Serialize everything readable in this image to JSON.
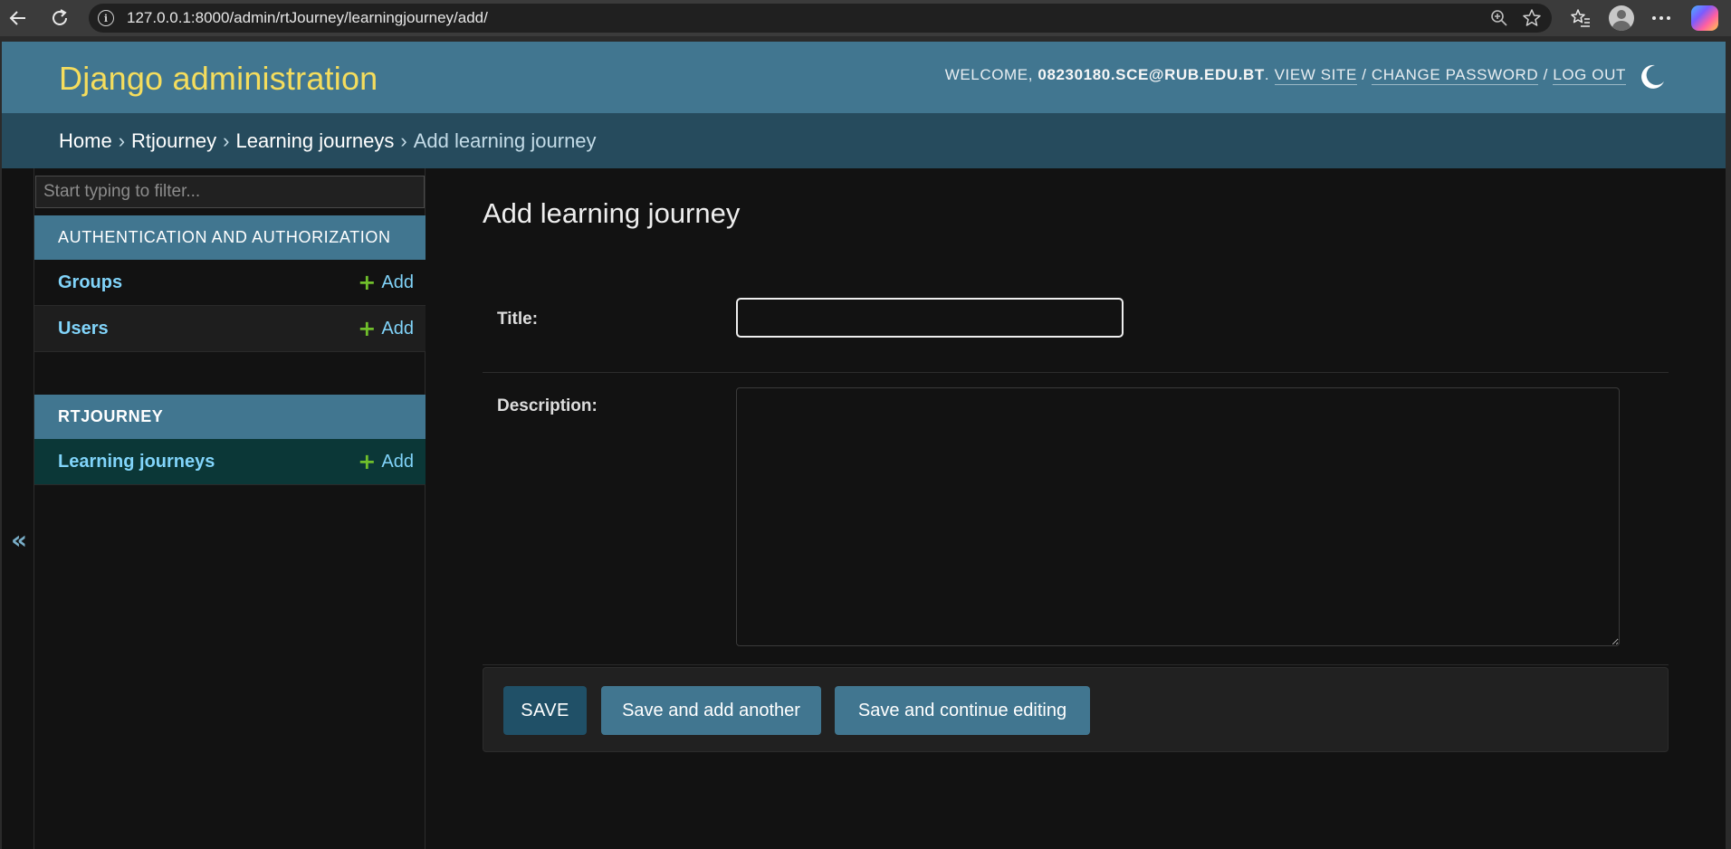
{
  "browser": {
    "url": "127.0.0.1:8000/admin/rtJourney/learningjourney/add/",
    "icons": [
      "back-arrow-icon",
      "reload-icon",
      "site-info-icon",
      "zoom-icon",
      "favorite-star-icon",
      "favorites-list-icon",
      "profile-avatar-icon",
      "more-menu-icon",
      "copilot-icon"
    ]
  },
  "header": {
    "branding": "Django administration",
    "welcome": "WELCOME,",
    "username": "08230180.SCE@RUB.EDU.BT",
    "view_site": "VIEW SITE",
    "change_password": "CHANGE PASSWORD",
    "log_out": "LOG OUT",
    "separator": "/",
    "period": "."
  },
  "breadcrumbs": {
    "home": "Home",
    "app": "Rtjourney",
    "model": "Learning journeys",
    "current": "Add learning journey",
    "separator": "›"
  },
  "sidebar": {
    "filter_placeholder": "Start typing to filter...",
    "collapse_toggle": "«",
    "modules": [
      {
        "caption": "AUTHENTICATION AND AUTHORIZATION",
        "models": [
          {
            "name": "Groups",
            "add_label": "Add"
          },
          {
            "name": "Users",
            "add_label": "Add"
          }
        ]
      },
      {
        "caption": "RTJOURNEY",
        "models": [
          {
            "name": "Learning journeys",
            "add_label": "Add"
          }
        ]
      }
    ]
  },
  "content": {
    "title": "Add learning journey",
    "fields": {
      "title_label": "Title:",
      "title_value": "",
      "description_label": "Description:",
      "description_value": ""
    },
    "buttons": {
      "save": "SAVE",
      "save_add_another": "Save and add another",
      "save_continue": "Save and continue editing"
    }
  },
  "colors": {
    "header_bg": "#417690",
    "breadcrumbs_bg": "#264b5d",
    "branding": "#f5dd5d",
    "link": "#81d4fa",
    "add_plus": "#70bf2b",
    "save_button": "#205067",
    "secondary_button": "#417690",
    "page_bg": "#121212",
    "selected_row_bg": "#0b3737"
  }
}
